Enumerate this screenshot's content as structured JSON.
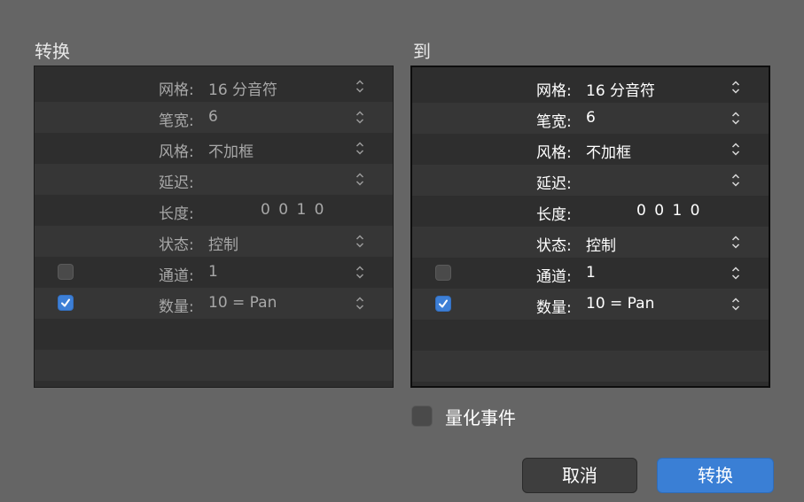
{
  "from": {
    "title": "转换",
    "rows": [
      {
        "label": "网格:",
        "value": "16 分音符"
      },
      {
        "label": "笔宽:",
        "value": "6"
      },
      {
        "label": "风格:",
        "value": "不加框"
      },
      {
        "label": "延迟:",
        "value": ""
      },
      {
        "label": "长度:",
        "value": "0 0 1    0"
      },
      {
        "label": "状态:",
        "value": "控制"
      },
      {
        "label": "通道:",
        "value": "1",
        "checked": false
      },
      {
        "label": "数量:",
        "value": "10 = Pan",
        "checked": true
      }
    ]
  },
  "to": {
    "title": "到",
    "rows": [
      {
        "label": "网格:",
        "value": "16 分音符"
      },
      {
        "label": "笔宽:",
        "value": "6"
      },
      {
        "label": "风格:",
        "value": "不加框"
      },
      {
        "label": "延迟:",
        "value": ""
      },
      {
        "label": "长度:",
        "value": "0 0 1    0"
      },
      {
        "label": "状态:",
        "value": "控制"
      },
      {
        "label": "通道:",
        "value": "1",
        "checked": false
      },
      {
        "label": "数量:",
        "value": "10 = Pan",
        "checked": true
      }
    ]
  },
  "quantize": {
    "label": "量化事件",
    "checked": false
  },
  "buttons": {
    "cancel": "取消",
    "convert": "转换"
  },
  "colors": {
    "accent": "#3a7fd5",
    "background": "#656565",
    "panel": "#2e2e2e"
  }
}
